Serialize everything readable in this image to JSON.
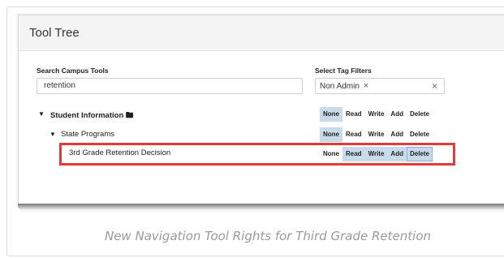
{
  "panel": {
    "title": "Tool Tree"
  },
  "search": {
    "label": "Search Campus Tools",
    "value": "retention"
  },
  "tags": {
    "label": "Select Tag Filters",
    "chip": "Non Admin",
    "chip_remove": "×",
    "clear": "×"
  },
  "tree": [
    {
      "caret": "▼",
      "label": "Student Information",
      "icon": "folder-icon",
      "folder_glyph": "🖿",
      "bold": true,
      "rights": [
        "None",
        "Read",
        "Write",
        "Add",
        "Delete"
      ],
      "active": [
        "None"
      ]
    },
    {
      "caret": "▼",
      "label": "State Programs",
      "bold": false,
      "rights": [
        "None",
        "Read",
        "Write",
        "Add",
        "Delete"
      ],
      "active": [
        "None"
      ]
    },
    {
      "label": "3rd Grade Retention Decision",
      "bold": false,
      "rights": [
        "None",
        "Read",
        "Write",
        "Add",
        "Delete"
      ],
      "active": [
        "Read",
        "Write",
        "Add",
        "Delete"
      ],
      "highlighted": true
    }
  ],
  "caption": "New Navigation Tool Rights for Third Grade Retention",
  "colors": {
    "active_right": "#c9dbea",
    "highlight": "#e5383b",
    "caption": "#9a9a9a"
  }
}
